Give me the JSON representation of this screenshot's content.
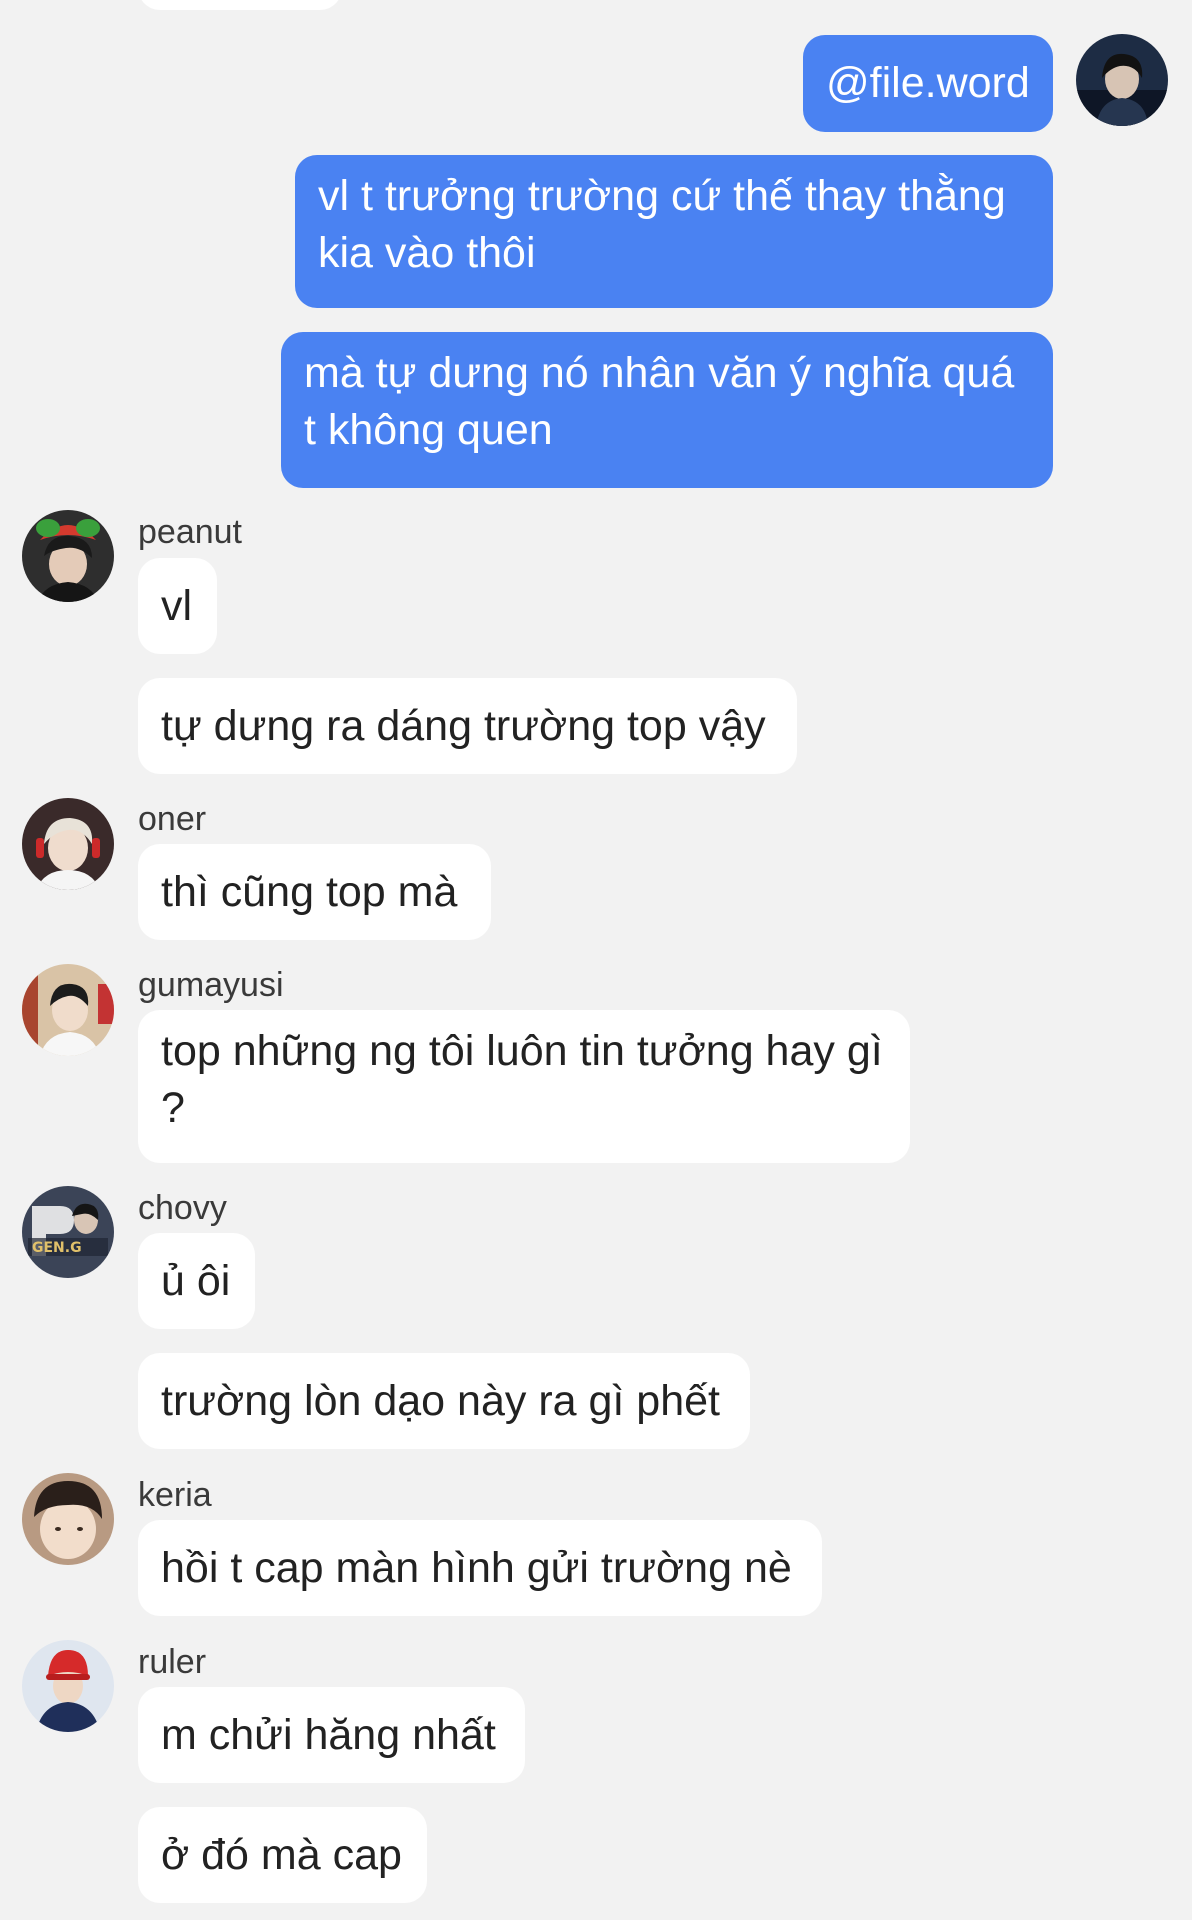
{
  "messages": {
    "outgoing": [
      "@file.word",
      "vl t trưởng trường cứ thế thay thằng kia vào thôi",
      "mà tự dưng nó nhân văn ý nghĩa quá t không quen"
    ],
    "groups": [
      {
        "sender": "peanut",
        "messages": [
          "vl",
          "tự dưng ra dáng trường top vậy"
        ]
      },
      {
        "sender": "oner",
        "messages": [
          "thì cũng top mà"
        ]
      },
      {
        "sender": "gumayusi",
        "messages": [
          "top những ng tôi luôn tin tưởng hay gì ?"
        ]
      },
      {
        "sender": "chovy",
        "messages": [
          "ủ ôi",
          "trường lòn dạo này ra gì phết"
        ]
      },
      {
        "sender": "keria",
        "messages": [
          "hồi t cap màn hình gửi trường nè"
        ]
      },
      {
        "sender": "ruler",
        "messages": [
          "m chửi hăng nhất",
          "ở đó mà cap"
        ]
      }
    ]
  },
  "avatar_text": {
    "chovy_logo": "GEN.G"
  },
  "colors": {
    "background": "#f2f2f2",
    "outgoing_bubble": "#4a82f2",
    "incoming_bubble": "#ffffff"
  }
}
